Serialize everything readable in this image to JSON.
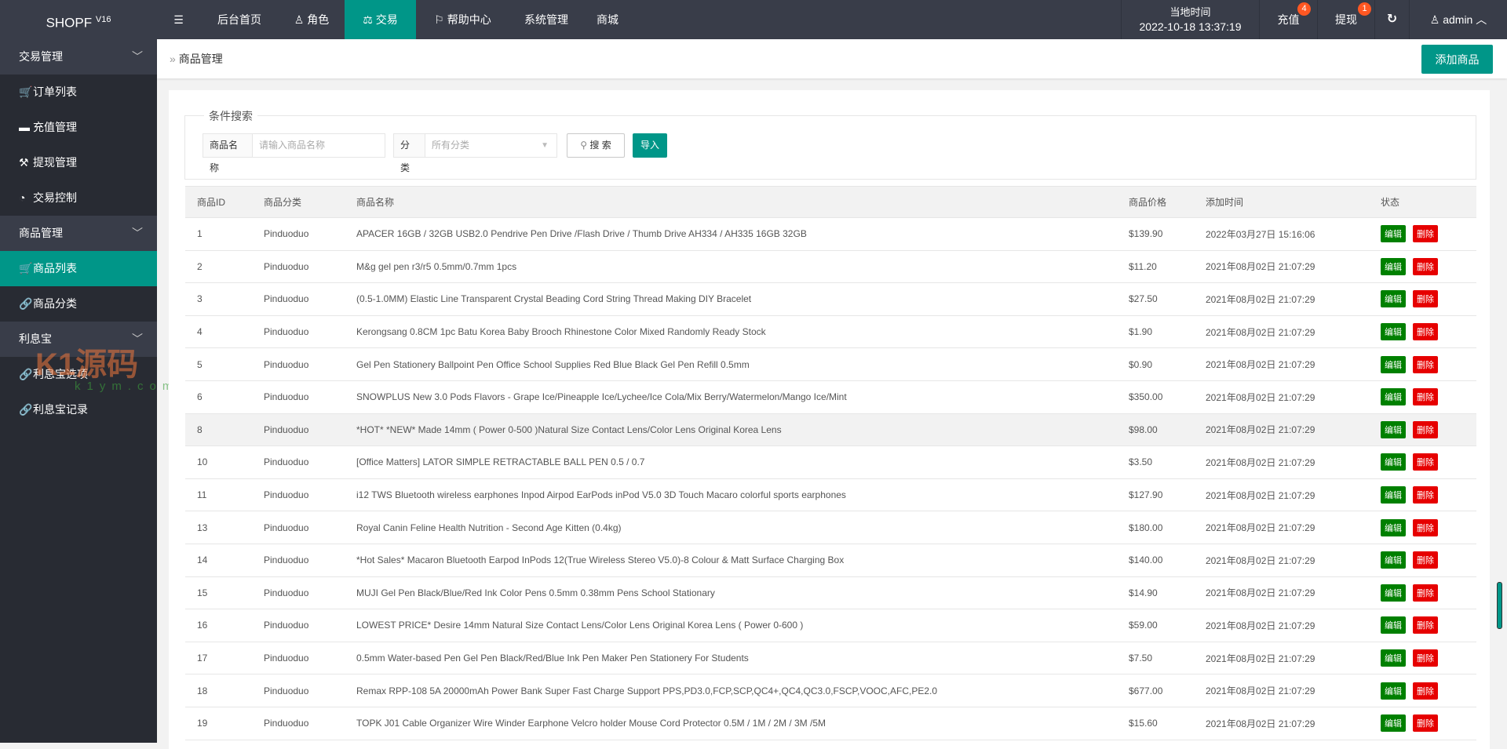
{
  "header": {
    "logo": "SHOPF",
    "version": "V16",
    "menu_toggle_icon": "menu-fold-icon",
    "nav": [
      {
        "label": "后台首页",
        "icon": ""
      },
      {
        "label": "角色",
        "icon": "user-icon"
      },
      {
        "label": "交易",
        "icon": "scale-icon",
        "active": true
      },
      {
        "label": "帮助中心",
        "icon": "flag-icon"
      },
      {
        "label": "系统管理",
        "icon": ""
      },
      {
        "label": "商城",
        "icon": ""
      }
    ],
    "time_label": "当地时间",
    "time_value": "2022-10-18 13:37:19",
    "recharge": {
      "label": "充值",
      "badge": "4"
    },
    "withdraw": {
      "label": "提现",
      "badge": "1"
    },
    "user": "admin"
  },
  "sidebar": {
    "groups": [
      {
        "label": "交易管理",
        "items": [
          {
            "label": "订单列表",
            "icon": "cart-outline-icon"
          },
          {
            "label": "充值管理",
            "icon": "screen-icon"
          },
          {
            "label": "提现管理",
            "icon": "hammer-icon"
          },
          {
            "label": "交易控制",
            "icon": "dashboard-icon"
          }
        ]
      },
      {
        "label": "商品管理",
        "items": [
          {
            "label": "商品列表",
            "icon": "cart-icon",
            "active": true
          },
          {
            "label": "商品分类",
            "icon": "link-icon"
          }
        ]
      },
      {
        "label": "利息宝",
        "items": [
          {
            "label": "利息宝选项",
            "icon": "link-icon"
          },
          {
            "label": "利息宝记录",
            "icon": "link-icon"
          }
        ]
      }
    ]
  },
  "breadcrumb": "商品管理",
  "add_button": "添加商品",
  "search": {
    "legend": "条件搜索",
    "name_label": "商品名称",
    "name_placeholder": "请输入商品名称",
    "category_label": "分类",
    "category_value": "所有分类",
    "search_button": "搜 索",
    "import_button": "导入"
  },
  "table": {
    "headers": [
      "商品ID",
      "商品分类",
      "商品名称",
      "商品价格",
      "添加时间",
      "状态"
    ],
    "edit_label": "编辑",
    "delete_label": "删除",
    "rows": [
      [
        "1",
        "Pinduoduo",
        "APACER 16GB / 32GB USB2.0 Pendrive Pen Drive /Flash Drive / Thumb Drive AH334 / AH335 16GB 32GB",
        "$139.90",
        "2022年03月27日 15:16:06"
      ],
      [
        "2",
        "Pinduoduo",
        "M&g gel pen r3/r5 0.5mm/0.7mm 1pcs",
        "$11.20",
        "2021年08月02日 21:07:29"
      ],
      [
        "3",
        "Pinduoduo",
        "(0.5-1.0MM) Elastic Line Transparent Crystal Beading Cord String Thread Making DIY Bracelet",
        "$27.50",
        "2021年08月02日 21:07:29"
      ],
      [
        "4",
        "Pinduoduo",
        "Kerongsang 0.8CM 1pc Batu Korea Baby Brooch Rhinestone Color Mixed Randomly Ready Stock",
        "$1.90",
        "2021年08月02日 21:07:29"
      ],
      [
        "5",
        "Pinduoduo",
        "Gel Pen Stationery Ballpoint Pen Office School Supplies Red Blue Black Gel Pen Refill 0.5mm",
        "$0.90",
        "2021年08月02日 21:07:29"
      ],
      [
        "6",
        "Pinduoduo",
        "SNOWPLUS New 3.0 Pods Flavors - Grape Ice/Pineapple Ice/Lychee/Ice Cola/Mix Berry/Watermelon/Mango Ice/Mint",
        "$350.00",
        "2021年08月02日 21:07:29"
      ],
      [
        "8",
        "Pinduoduo",
        "*HOT* *NEW* Made 14mm ( Power 0-500 )Natural Size Contact Lens/Color Lens Original Korea Lens",
        "$98.00",
        "2021年08月02日 21:07:29"
      ],
      [
        "10",
        "Pinduoduo",
        "[Office Matters] LATOR SIMPLE RETRACTABLE BALL PEN 0.5 / 0.7",
        "$3.50",
        "2021年08月02日 21:07:29"
      ],
      [
        "11",
        "Pinduoduo",
        "i12 TWS Bluetooth wireless earphones Inpod Airpod EarPods inPod V5.0 3D Touch Macaro colorful sports earphones",
        "$127.90",
        "2021年08月02日 21:07:29"
      ],
      [
        "13",
        "Pinduoduo",
        "Royal Canin Feline Health Nutrition - Second Age Kitten (0.4kg)",
        "$180.00",
        "2021年08月02日 21:07:29"
      ],
      [
        "14",
        "Pinduoduo",
        "*Hot Sales* Macaron Bluetooth Earpod InPods 12(True Wireless Stereo V5.0)-8 Colour & Matt Surface Charging Box",
        "$140.00",
        "2021年08月02日 21:07:29"
      ],
      [
        "15",
        "Pinduoduo",
        "MUJI Gel Pen Black/Blue/Red Ink Color Pens 0.5mm 0.38mm Pens School Stationary",
        "$14.90",
        "2021年08月02日 21:07:29"
      ],
      [
        "16",
        "Pinduoduo",
        "LOWEST PRICE* Desire 14mm Natural Size Contact Lens/Color Lens Original Korea Lens ( Power 0-600 )",
        "$59.00",
        "2021年08月02日 21:07:29"
      ],
      [
        "17",
        "Pinduoduo",
        "0.5mm Water-based Pen Gel Pen Black/Red/Blue Ink Pen Maker Pen Stationery For Students",
        "$7.50",
        "2021年08月02日 21:07:29"
      ],
      [
        "18",
        "Pinduoduo",
        "Remax RPP-108 5A 20000mAh Power Bank Super Fast Charge Support PPS,PD3.0,FCP,SCP,QC4+,QC4,QC3.0,FSCP,VOOC,AFC,PE2.0",
        "$677.00",
        "2021年08月02日 21:07:29"
      ],
      [
        "19",
        "Pinduoduo",
        "TOPK J01 Cable Organizer Wire Winder Earphone Velcro holder Mouse Cord Protector 0.5M / 1M / 2M / 3M /5M",
        "$15.60",
        "2021年08月02日 21:07:29"
      ]
    ]
  },
  "watermark": {
    "text": "K1源码",
    "url": "k1ym.com"
  },
  "colors": {
    "accent": "#009688",
    "header": "#393d49",
    "sidebar": "#282b33",
    "edit": "#008000",
    "delete": "#e60000",
    "badge": "#ff5722"
  }
}
